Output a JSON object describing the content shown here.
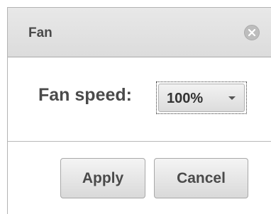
{
  "dialog": {
    "title": "Fan",
    "close_icon": "close-x-circle-icon"
  },
  "fan_speed": {
    "label": "Fan speed:",
    "selected": "100%"
  },
  "buttons": {
    "apply": "Apply",
    "cancel": "Cancel"
  }
}
